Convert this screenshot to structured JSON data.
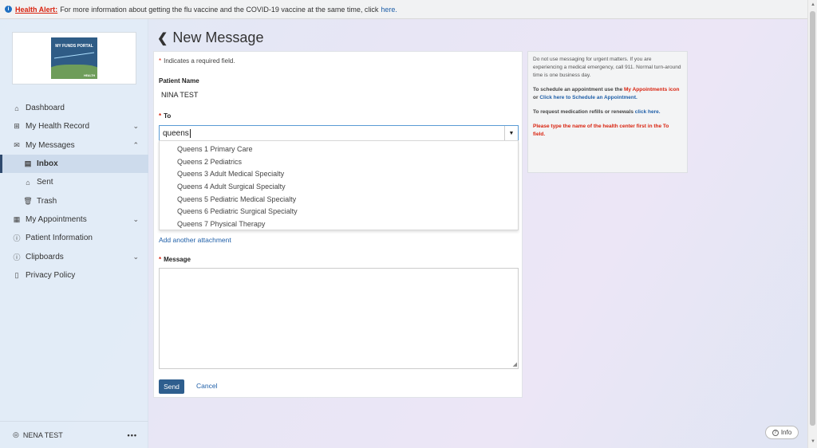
{
  "alert": {
    "label": "Health Alert:",
    "text": "For more information about getting the flu vaccine and the COVID-19 vaccine at the same time, click",
    "link": "here."
  },
  "logo": {
    "title": "MY FUNDS PORTAL",
    "sub": "HEALTH"
  },
  "nav": {
    "dashboard": "Dashboard",
    "health_record": "My Health Record",
    "messages": "My Messages",
    "inbox": "Inbox",
    "sent": "Sent",
    "trash": "Trash",
    "appointments": "My Appointments",
    "patient_info": "Patient Information",
    "clipboards": "Clipboards",
    "privacy": "Privacy Policy"
  },
  "user": {
    "name": "NENA TEST",
    "more": "•••"
  },
  "page": {
    "title": "New Message"
  },
  "form": {
    "required_note": "Indicates a required field.",
    "patient_label": "Patient Name",
    "patient_name": "NINA TEST",
    "to_label": "To",
    "to_value": "queens",
    "options": [
      "Queens 1 Primary Care",
      "Queens 2 Pediatrics",
      "Queens 3 Adult Medical Specialty",
      "Queens 4 Adult Surgical Specialty",
      "Queens 5 Pediatric Medical Specialty",
      "Queens 6 Pediatric Surgical Specialty",
      "Queens 7 Physical Therapy"
    ],
    "add_attachment": "Add another attachment",
    "message_label": "Message",
    "send": "Send",
    "cancel": "Cancel"
  },
  "info": {
    "p1": "Do not use messaging for urgent matters. If you are experiencing a medical emergency, call 911. Normal turn-around time is one business day.",
    "p2a": "To schedule an appointment use the",
    "p2b": "My Appointments icon",
    "p2c": "or",
    "p2d": "Click here to Schedule an Appointment.",
    "p3a": "To request medication refills or renewals",
    "p3b": "click here.",
    "p4": "Please type the name of the health center first in the To field."
  },
  "info_button": "Info"
}
